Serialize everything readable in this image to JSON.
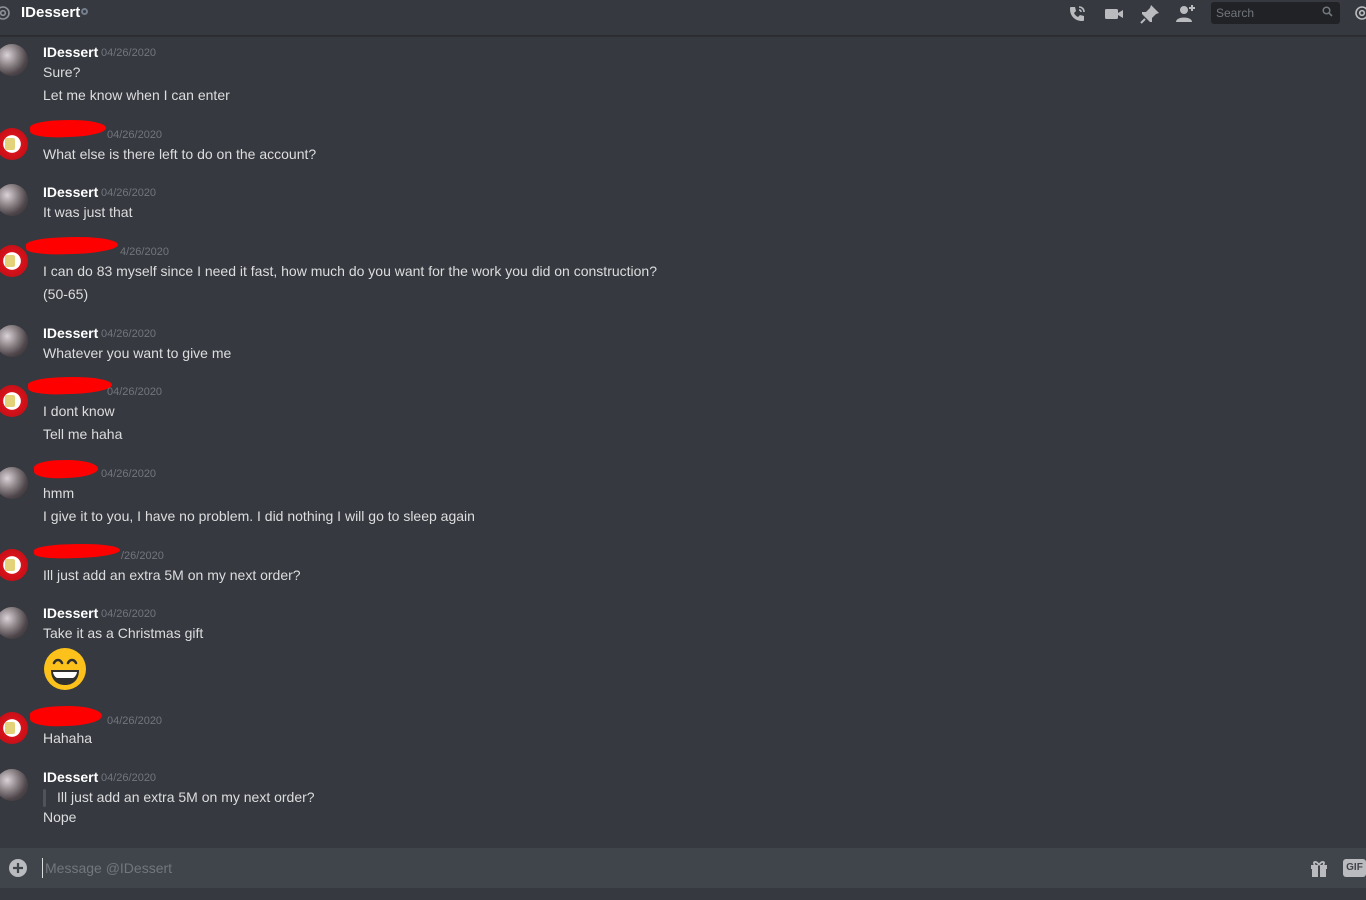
{
  "header": {
    "channel_name": "IDessert",
    "search_placeholder": "Search",
    "icons": [
      "at-icon",
      "start-voice-call-icon",
      "start-video-call-icon",
      "pinned-messages-icon",
      "add-friend-icon",
      "search-icon",
      "mention-icon"
    ]
  },
  "messages": [
    {
      "author": "IDessert",
      "timestamp": "04/26/2020",
      "lines": [
        "Sure?",
        "Let me know when I can enter"
      ]
    },
    {
      "author": "",
      "timestamp": "04/26/2020",
      "lines": [
        "What else is there left to do on the account?"
      ]
    },
    {
      "author": "IDessert",
      "timestamp": "04/26/2020",
      "lines": [
        "It was just that"
      ]
    },
    {
      "author": "",
      "timestamp": "4/26/2020",
      "lines": [
        "I can do 83 myself since I need it fast, how much do you want for the work you did on construction?",
        "(50-65)"
      ]
    },
    {
      "author": "IDessert",
      "timestamp": "04/26/2020",
      "lines": [
        "Whatever you want to give me"
      ]
    },
    {
      "author": "",
      "timestamp": "04/26/2020",
      "lines": [
        "I dont know",
        "Tell me haha"
      ]
    },
    {
      "author": "",
      "timestamp": "04/26/2020",
      "lines": [
        "hmm",
        "I give it to you, I have no problem. I did nothing I will go to sleep again"
      ]
    },
    {
      "author": "",
      "timestamp": "/26/2020",
      "lines": [
        "Ill just add an extra 5M on my next order?"
      ]
    },
    {
      "author": "IDessert",
      "timestamp": "04/26/2020",
      "lines": [
        "Take it as a Christmas gift"
      ],
      "emoji": "grinning-face-emoji"
    },
    {
      "author": "",
      "timestamp": "04/26/2020",
      "lines": [
        "Hahaha"
      ]
    },
    {
      "author": "IDessert",
      "timestamp": "04/26/2020",
      "quote": "Ill just add an extra 5M on my next order?",
      "lines": [
        "Nope"
      ]
    }
  ],
  "composer": {
    "placeholder": "Message @IDessert",
    "gif_label": "GIF"
  },
  "colors": {
    "background": "#36393f",
    "composer": "#40444b",
    "redaction": "#ff0000",
    "username": "#ffffff",
    "timestamp": "#72767d"
  }
}
